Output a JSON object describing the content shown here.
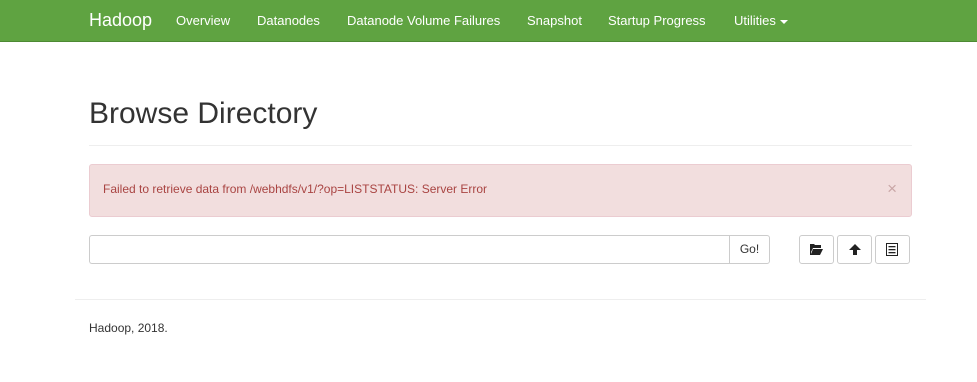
{
  "navbar": {
    "brand": "Hadoop",
    "items": [
      {
        "label": "Overview"
      },
      {
        "label": "Datanodes"
      },
      {
        "label": "Datanode Volume Failures"
      },
      {
        "label": "Snapshot"
      },
      {
        "label": "Startup Progress"
      },
      {
        "label": "Utilities",
        "has_dropdown": true
      }
    ],
    "color": "#5fa341"
  },
  "page": {
    "title": "Browse Directory"
  },
  "alert": {
    "message": "Failed to retrieve data from /webhdfs/v1/?op=LISTSTATUS: Server Error",
    "close_symbol": "×",
    "background": "#f2dede",
    "text_color": "#a94442"
  },
  "path_bar": {
    "value": "",
    "go_label": "Go!"
  },
  "actions": [
    {
      "icon": "folder-open-icon"
    },
    {
      "icon": "upload-icon"
    },
    {
      "icon": "list-alt-icon"
    }
  ],
  "footer": {
    "text": "Hadoop, 2018."
  }
}
